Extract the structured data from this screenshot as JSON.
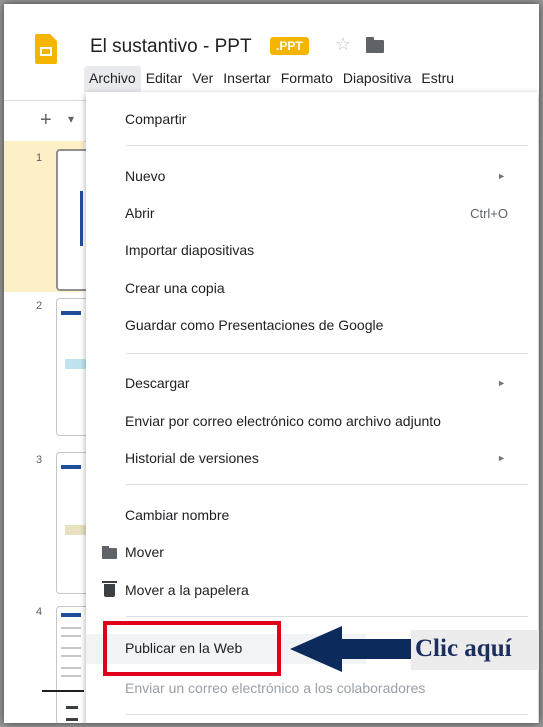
{
  "header": {
    "title": "El sustantivo - PPT",
    "badge": ".PPT",
    "star_icon": "star-outline",
    "folder_icon": "folder"
  },
  "menubar": [
    "Archivo",
    "Editar",
    "Ver",
    "Insertar",
    "Formato",
    "Diapositiva",
    "Estru"
  ],
  "toolbar": {
    "plus": "+",
    "caret": "▾"
  },
  "filmstrip": {
    "slides": [
      "1",
      "2",
      "3",
      "4"
    ],
    "selected": "1"
  },
  "file_menu": {
    "items": [
      {
        "label": "Compartir"
      },
      {
        "label": "Nuevo",
        "submenu": "►"
      },
      {
        "label": "Abrir",
        "shortcut": "Ctrl+O"
      },
      {
        "label": "Importar diapositivas"
      },
      {
        "label": "Crear una copia"
      },
      {
        "label": "Guardar como Presentaciones de Google"
      },
      {
        "label": "Descargar",
        "submenu": "►"
      },
      {
        "label": "Enviar por correo electrónico como archivo adjunto"
      },
      {
        "label": "Historial de versiones",
        "submenu": "►"
      },
      {
        "label": "Cambiar nombre"
      },
      {
        "label": "Mover",
        "icon": "folder"
      },
      {
        "label": "Mover a la papelera",
        "icon": "trash"
      },
      {
        "label": "Publicar en la Web"
      },
      {
        "label": "Enviar un correo electrónico a los colaboradores",
        "disabled": true
      }
    ]
  },
  "annotation": {
    "callout": "Clic aquí",
    "highlight_color": "#e0001a",
    "arrow_color": "#0d2a5c"
  },
  "colors": {
    "brand": "#f4b400",
    "menu_bg": "#ffffff",
    "selected_slide": "#fdf0c6"
  }
}
